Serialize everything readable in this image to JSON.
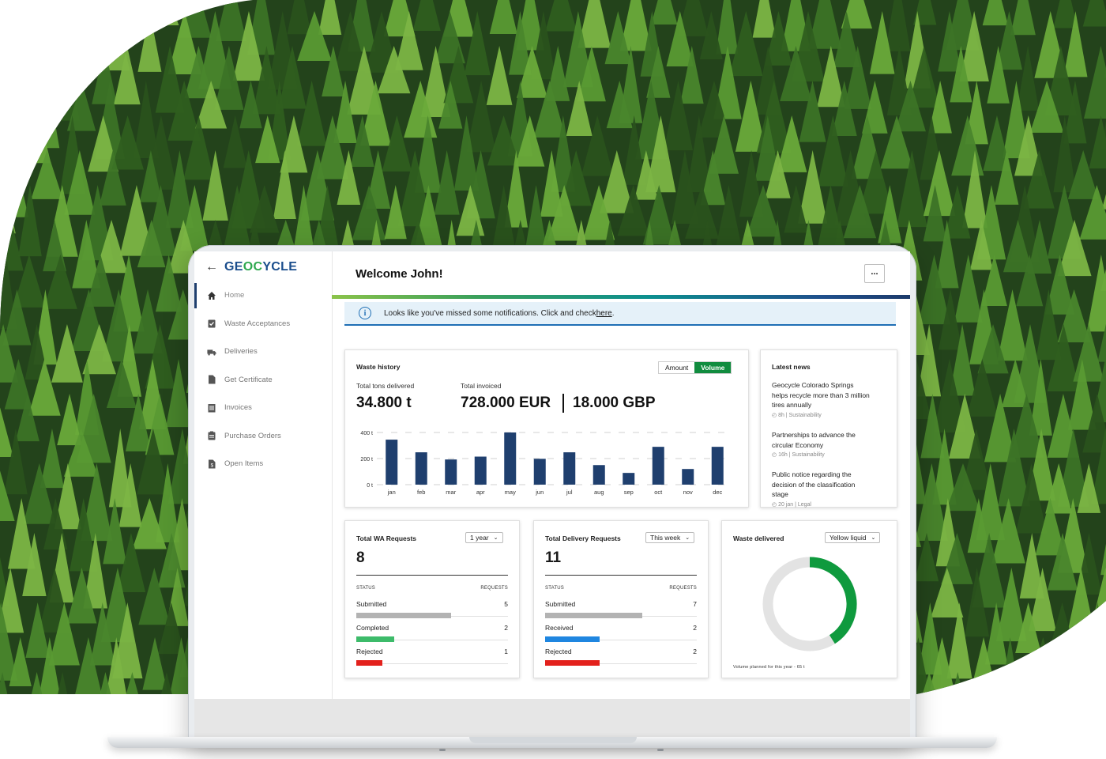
{
  "app": {
    "logo": {
      "pre": "GE",
      "mid": "OC",
      "post": "YCLE"
    },
    "welcome": "Welcome John!",
    "more_label": "...",
    "alert": {
      "text": "Looks like you've missed some notifications. Click and check ",
      "link": "here",
      "suffix": "."
    }
  },
  "sidebar": {
    "items": [
      {
        "label": "Home",
        "icon": "home-icon"
      },
      {
        "label": "Waste Acceptances",
        "icon": "clipboard-check-icon"
      },
      {
        "label": "Deliveries",
        "icon": "truck-icon"
      },
      {
        "label": "Get Certificate",
        "icon": "document-icon"
      },
      {
        "label": "Invoices",
        "icon": "invoice-icon"
      },
      {
        "label": "Purchase Orders",
        "icon": "purchase-order-icon"
      },
      {
        "label": "Open Items",
        "icon": "open-items-icon"
      }
    ]
  },
  "waste_history": {
    "title": "Waste history",
    "toggle": {
      "amount": "Amount",
      "volume": "Volume",
      "selected": "Volume"
    },
    "tons_label": "Total tons delivered",
    "tons_value": "34.800 t",
    "invoiced_label": "Total invoiced",
    "invoiced_eur": "728.000 EUR",
    "invoiced_gbp": "18.000 GBP"
  },
  "chart_data": {
    "type": "bar",
    "categories": [
      "jan",
      "feb",
      "mar",
      "apr",
      "may",
      "jun",
      "jul",
      "aug",
      "sep",
      "oct",
      "nov",
      "dec"
    ],
    "values": [
      345,
      248,
      193,
      215,
      400,
      198,
      248,
      150,
      90,
      290,
      120,
      290
    ],
    "ylim": [
      0,
      400
    ],
    "yticks": [
      "400 t",
      "200 t",
      "0 t"
    ],
    "ytick_values": [
      400,
      200,
      0
    ],
    "bar_color": "#1f3f6e",
    "grid": "dashed"
  },
  "news": {
    "title": "Latest news",
    "items": [
      {
        "title": "Geocycle Colorado Springs helps recycle more than 3 million tires annually",
        "meta": "8h  |  Sustainability"
      },
      {
        "title": "Partnerships to advance the circular Economy",
        "meta": "16h  |  Sustainability"
      },
      {
        "title": "Public notice regarding the decision of the classification stage",
        "meta": "20 jan  |  Legal"
      }
    ]
  },
  "wa_requests": {
    "title": "Total WA Requests",
    "period": "1 year",
    "count": "8",
    "col_status": "STATUS",
    "col_requests": "REQUESTS",
    "rows": [
      {
        "label": "Submitted",
        "value": "5",
        "fraction": 0.625,
        "color": "#b3b3b3"
      },
      {
        "label": "Completed",
        "value": "2",
        "fraction": 0.25,
        "color": "#3dbb6a"
      },
      {
        "label": "Rejected",
        "value": "1",
        "fraction": 0.17,
        "color": "#e3211c"
      }
    ]
  },
  "delivery_requests": {
    "title": "Total Delivery Requests",
    "period": "This week",
    "count": "11",
    "col_status": "STATUS",
    "col_requests": "REQUESTS",
    "rows": [
      {
        "label": "Submitted",
        "value": "7",
        "fraction": 0.64,
        "color": "#b3b3b3"
      },
      {
        "label": "Received",
        "value": "2",
        "fraction": 0.36,
        "color": "#1f86e0"
      },
      {
        "label": "Rejected",
        "value": "2",
        "fraction": 0.36,
        "color": "#e3211c"
      }
    ]
  },
  "waste_delivered": {
    "title": "Waste delivered",
    "filter": "Yellow liquid",
    "fraction": 0.41,
    "ring_color": "#0f9a3e",
    "track_color": "#e3e3e3",
    "footnote": "Volume planned for this year - 65 t"
  }
}
